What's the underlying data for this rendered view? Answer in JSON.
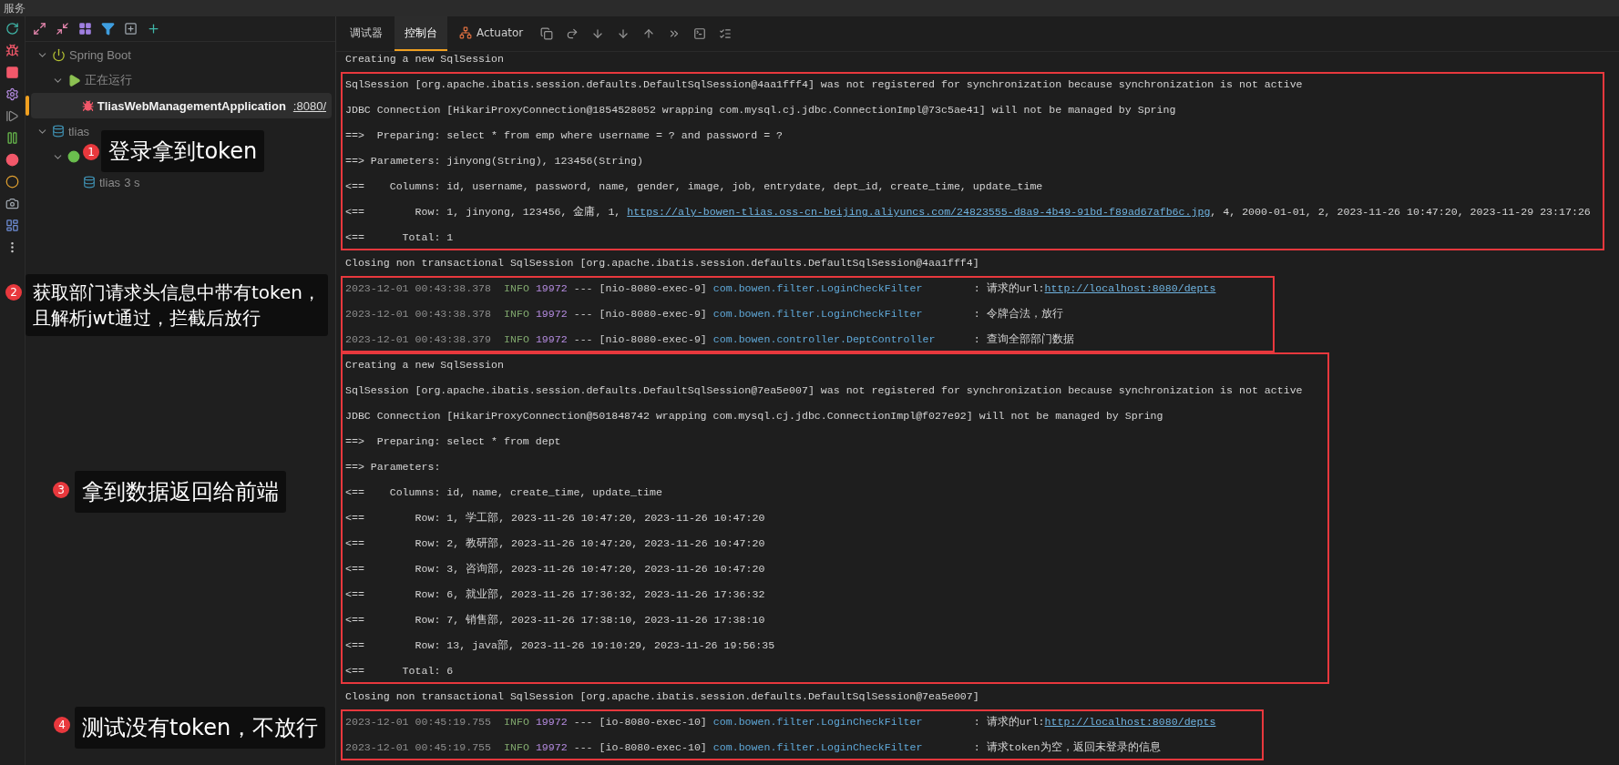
{
  "window": {
    "title": "服务"
  },
  "sidebar": {
    "tree": [
      {
        "label": "Spring Boot",
        "kind": "power",
        "expanded": true,
        "selected": false,
        "children": [
          {
            "label": "正在运行",
            "kind": "play",
            "expanded": true,
            "selected": false,
            "children": [
              {
                "label": "TliasWebManagementApplication",
                "port": ":8080/",
                "kind": "bug",
                "selected": true
              }
            ]
          }
        ]
      },
      {
        "label": "tlias",
        "kind": "database",
        "expanded": true,
        "selected": false,
        "children": [
          {
            "kind": "dot",
            "expanded": true,
            "selected": false,
            "children": [
              {
                "label": "tlias",
                "suffix": "3 s",
                "kind": "database",
                "selected": false
              }
            ]
          }
        ]
      }
    ]
  },
  "tabs": [
    {
      "label": "调试器",
      "selected": false,
      "kind": "text"
    },
    {
      "label": "控制台",
      "selected": true,
      "kind": "text"
    },
    {
      "label": "Actuator",
      "selected": false,
      "kind": "actuator"
    }
  ],
  "console": {
    "blocks": [
      {
        "boxed": false,
        "lines": [
          {
            "kind": "text",
            "text": "Creating a new SqlSession"
          }
        ]
      },
      {
        "boxed": true,
        "lines": [
          {
            "kind": "text",
            "text": "SqlSession [org.apache.ibatis.session.defaults.DefaultSqlSession@4aa1fff4] was not registered for synchronization because synchronization is not active"
          },
          {
            "kind": "text",
            "text": "JDBC Connection [HikariProxyConnection@1854528052 wrapping com.mysql.cj.jdbc.ConnectionImpl@73c5ae41] will not be managed by Spring"
          },
          {
            "kind": "text",
            "text": "==>  Preparing: select * from emp where username = ? and password = ?"
          },
          {
            "kind": "text",
            "text": "==> Parameters: jinyong(String), 123456(String)"
          },
          {
            "kind": "text",
            "text": "<==    Columns: id, username, password, name, gender, image, job, entrydate, dept_id, create_time, update_time"
          },
          {
            "kind": "text",
            "text": "<==        Row: 1, jinyong, 123456, 金庸, 1, ",
            "link": "https://aly-bowen-tlias.oss-cn-beijing.aliyuncs.com/24823555-d8a9-4b49-91bd-f89ad67afb6c.jpg",
            "after": ", 4, 2000-01-01, 2, 2023-11-26 10:47:20, 2023-11-29 23:17:26"
          },
          {
            "kind": "text",
            "text": "<==      Total: 1"
          }
        ]
      },
      {
        "boxed": false,
        "lines": [
          {
            "kind": "text",
            "text": "Closing non transactional SqlSession [org.apache.ibatis.session.defaults.DefaultSqlSession@4aa1fff4]"
          }
        ]
      },
      {
        "boxed": true,
        "lines": [
          {
            "kind": "log",
            "time": "2023-12-01 00:43:38.378",
            "level": "INFO",
            "pid": "19972",
            "sep": "---",
            "thread": "[nio-8080-exec-9]",
            "logger": "com.bowen.filter.LoginCheckFilter",
            "message": ": 请求的url:",
            "link": "http://localhost:8080/depts"
          },
          {
            "kind": "log",
            "time": "2023-12-01 00:43:38.378",
            "level": "INFO",
            "pid": "19972",
            "sep": "---",
            "thread": "[nio-8080-exec-9]",
            "logger": "com.bowen.filter.LoginCheckFilter",
            "message": ": 令牌合法，放行"
          },
          {
            "kind": "log",
            "time": "2023-12-01 00:43:38.379",
            "level": "INFO",
            "pid": "19972",
            "sep": "---",
            "thread": "[nio-8080-exec-9]",
            "logger": "com.bowen.controller.DeptController",
            "message": ": 查询全部部门数据"
          }
        ]
      },
      {
        "boxed": true,
        "lines": [
          {
            "kind": "text",
            "text": "Creating a new SqlSession"
          },
          {
            "kind": "text",
            "text": "SqlSession [org.apache.ibatis.session.defaults.DefaultSqlSession@7ea5e007] was not registered for synchronization because synchronization is not active"
          },
          {
            "kind": "text",
            "text": "JDBC Connection [HikariProxyConnection@501848742 wrapping com.mysql.cj.jdbc.ConnectionImpl@f027e92] will not be managed by Spring"
          },
          {
            "kind": "text",
            "text": "==>  Preparing: select * from dept"
          },
          {
            "kind": "text",
            "text": "==> Parameters: "
          },
          {
            "kind": "text",
            "text": "<==    Columns: id, name, create_time, update_time"
          },
          {
            "kind": "text",
            "text": "<==        Row: 1, 学工部, 2023-11-26 10:47:20, 2023-11-26 10:47:20"
          },
          {
            "kind": "text",
            "text": "<==        Row: 2, 教研部, 2023-11-26 10:47:20, 2023-11-26 10:47:20"
          },
          {
            "kind": "text",
            "text": "<==        Row: 3, 咨询部, 2023-11-26 10:47:20, 2023-11-26 10:47:20"
          },
          {
            "kind": "text",
            "text": "<==        Row: 6, 就业部, 2023-11-26 17:36:32, 2023-11-26 17:36:32"
          },
          {
            "kind": "text",
            "text": "<==        Row: 7, 销售部, 2023-11-26 17:38:10, 2023-11-26 17:38:10"
          },
          {
            "kind": "text",
            "text": "<==        Row: 13, java部, 2023-11-26 19:10:29, 2023-11-26 19:56:35"
          },
          {
            "kind": "text",
            "text": "<==      Total: 6"
          }
        ]
      },
      {
        "boxed": false,
        "lines": [
          {
            "kind": "text",
            "text": "Closing non transactional SqlSession [org.apache.ibatis.session.defaults.DefaultSqlSession@7ea5e007]"
          }
        ]
      },
      {
        "boxed": true,
        "lines": [
          {
            "kind": "log",
            "time": "2023-12-01 00:45:19.755",
            "level": "INFO",
            "pid": "19972",
            "sep": "---",
            "thread": "[io-8080-exec-10]",
            "logger": "com.bowen.filter.LoginCheckFilter",
            "message": ": 请求的url:",
            "link": "http://localhost:8080/depts"
          },
          {
            "kind": "log",
            "time": "2023-12-01 00:45:19.755",
            "level": "INFO",
            "pid": "19972",
            "sep": "---",
            "thread": "[io-8080-exec-10]",
            "logger": "com.bowen.filter.LoginCheckFilter",
            "message": ": 请求token为空，返回未登录的信息"
          }
        ]
      }
    ]
  },
  "annotations": [
    {
      "number": "1",
      "lines": [
        "登录拿到token"
      ]
    },
    {
      "number": "2",
      "lines": [
        "获取部门请求头信息中带有token，",
        "且解析jwt通过，拦截后放行"
      ]
    },
    {
      "number": "3",
      "lines": [
        "拿到数据返回给前端"
      ]
    },
    {
      "number": "4",
      "lines": [
        "测试没有token，不放行"
      ]
    }
  ]
}
